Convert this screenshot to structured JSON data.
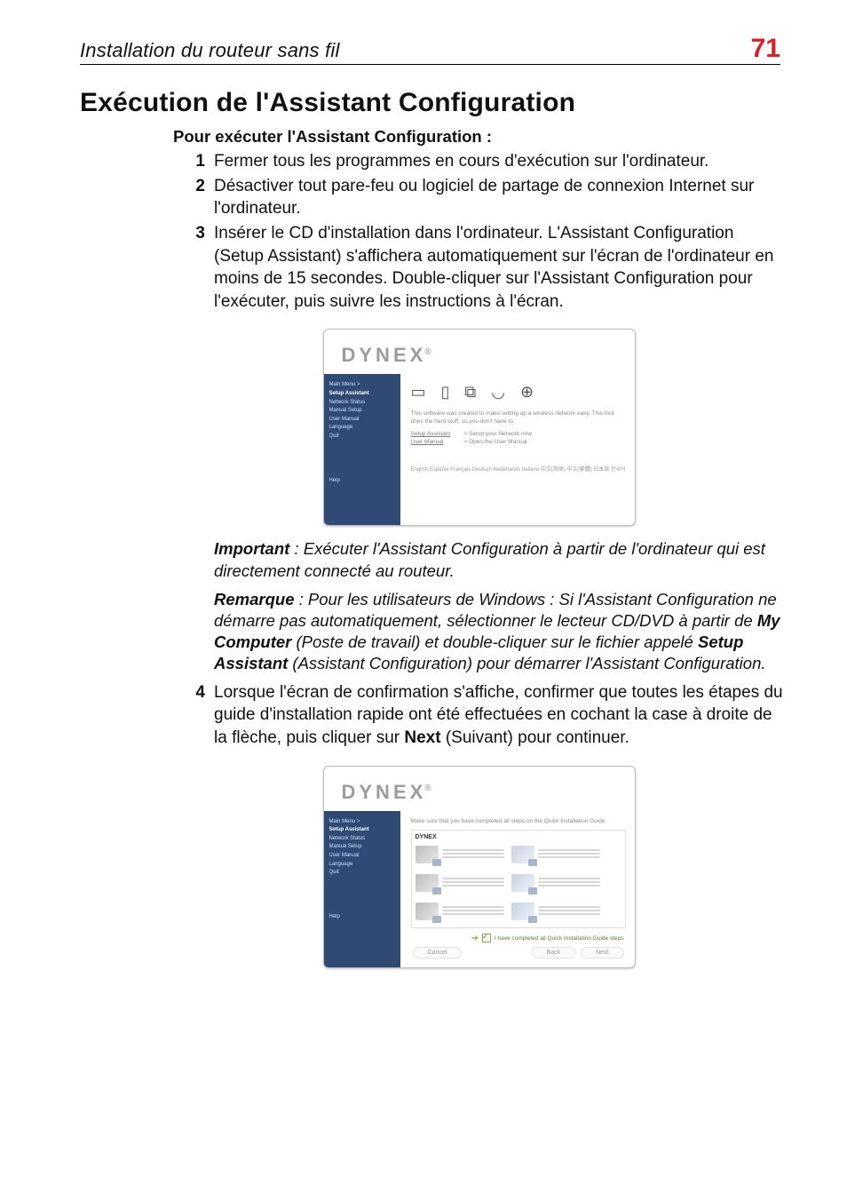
{
  "header": {
    "title": "Installation du routeur sans fil",
    "page_number": "71"
  },
  "section_heading": "Exécution de l'Assistant Configuration",
  "subheading": "Pour exécuter l'Assistant Configuration :",
  "steps": {
    "1": "Fermer tous les programmes en cours d'exécution sur l'ordinateur.",
    "2": "Désactiver tout pare-feu ou logiciel de partage de connexion Internet sur l'ordinateur.",
    "3": "Insérer le CD d'installation dans l'ordinateur. L'Assistant Configuration (Setup Assistant) s'affichera automatiquement sur l'écran de l'ordinateur en moins de 15 secondes. Double-cliquer sur l'Assistant Configuration pour l'exécuter, puis suivre les instructions à l'écran.",
    "4_pre": "Lorsque l'écran de confirmation s'affiche, confirmer que toutes les étapes du guide d'installation rapide ont été effectuées en cochant la case à droite de la flèche, puis cliquer sur ",
    "4_bold": "Next",
    "4_post": " (Suivant) pour continuer."
  },
  "notes": {
    "important_label": "Important",
    "important_text": " : Exécuter l'Assistant Configuration à partir de l'ordinateur qui est directement connecté au routeur.",
    "remarque_label": "Remarque",
    "remarque_pre": " : Pour les utilisateurs de Windows : Si l'Assistant Configuration ne démarre pas automatiquement, sélectionner le lecteur CD/DVD à partir de ",
    "remarque_bold1": "My Computer",
    "remarque_mid": " (Poste de travail) et double-cliquer sur le fichier appelé ",
    "remarque_bold2": "Setup Assistant",
    "remarque_post": " (Assistant Configuration) pour démarrer l'Assistant Configuration."
  },
  "screenshot1": {
    "brand": "DYNEX",
    "side_items": [
      "Main Menu  >",
      "Setup Assistant",
      "Network Status",
      "Manual Setup",
      "User Manual",
      "Language",
      "Quit"
    ],
    "side_help": "Help",
    "tiny_text": "This software was created to make setting up a wireless network easy. This tool does the hard stuff, so you don't have to.",
    "link1_left": "Setup Assistant",
    "link1_right": "> Setup your Network now",
    "link2_left": "User Manual",
    "link2_right": "> Open the User Manual",
    "langs": "English  Español  Français  Deutsch  Nederlands  Italiano  中文(简体)  中文(繁體)  日本語  한국어"
  },
  "screenshot2": {
    "brand": "DYNEX",
    "side_items": [
      "Main Menu  >",
      "Setup Assistant",
      "Network Status",
      "Manual Setup",
      "User Manual",
      "Language",
      "Quit"
    ],
    "side_help": "Help",
    "tip": "Make sure that you have completed all steps on the Quick Installation Guide",
    "thumb_brand": "DYNEX",
    "confirm_text": "I have completed all Quick Installation Guide steps",
    "btn_cancel": "Cancel",
    "btn_back": "Back",
    "btn_next": "Next"
  }
}
